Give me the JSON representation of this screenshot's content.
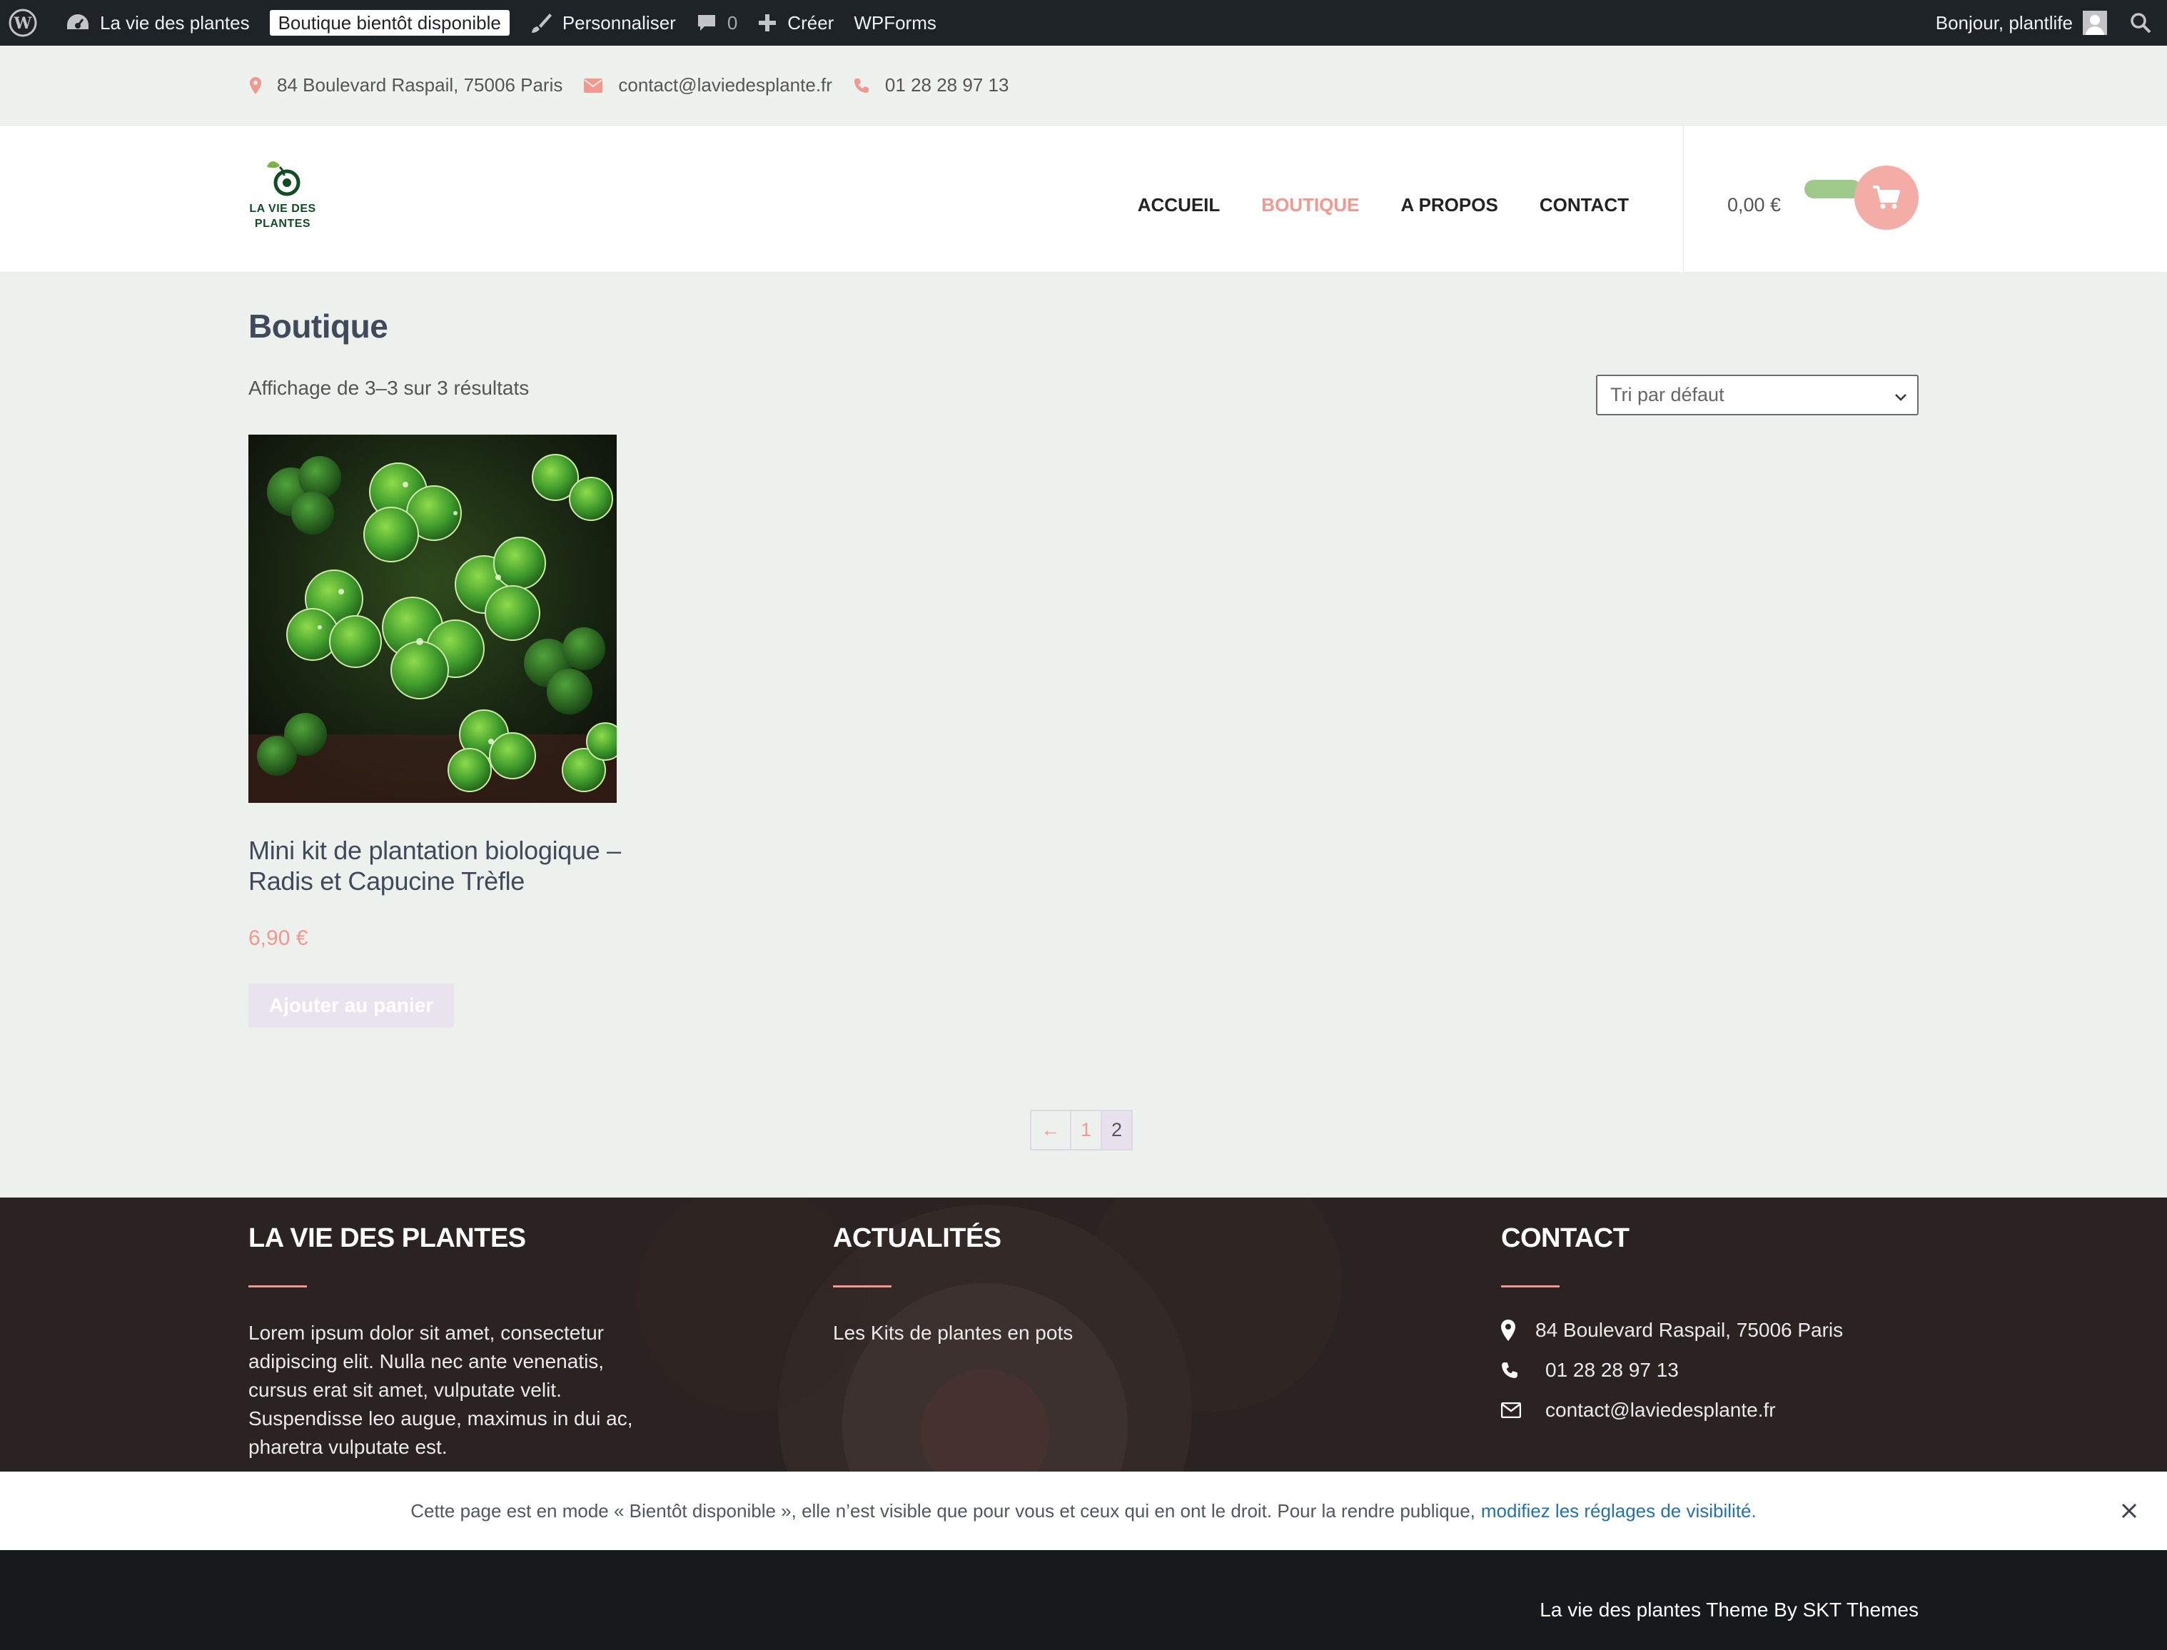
{
  "admin_bar": {
    "site_name": "La vie des plantes",
    "coming_soon_badge": "Boutique bientôt disponible",
    "customize": "Personnaliser",
    "comments_count": "0",
    "new": "Créer",
    "wpforms": "WPForms",
    "greeting": "Bonjour, plantlife"
  },
  "top_info": {
    "address": "84 Boulevard Raspail, 75006 Paris",
    "email": "contact@laviedesplante.fr",
    "phone": "01 28 28 97 13"
  },
  "header": {
    "logo_line1": "LA VIE DES",
    "logo_line2": "PLANTES",
    "nav": [
      {
        "label": "ACCUEIL",
        "active": false
      },
      {
        "label": "BOUTIQUE",
        "active": true
      },
      {
        "label": "A PROPOS",
        "active": false
      },
      {
        "label": "CONTACT",
        "active": false
      }
    ],
    "cart_total": "0,00 €"
  },
  "main": {
    "title": "Boutique",
    "result_count": "Affichage de 3–3 sur 3 résultats",
    "sort": {
      "selected": "Tri par défaut"
    },
    "product": {
      "title": "Mini kit de plantation biologique – Radis et Capucine Trèfle",
      "price": "6,90 €",
      "add_to_cart": "Ajouter au panier"
    },
    "pagination": {
      "prev": "←",
      "pages": [
        "1",
        "2"
      ],
      "current": "2"
    }
  },
  "footer": {
    "about": {
      "heading": "LA VIE DES PLANTES",
      "text": "Lorem ipsum dolor sit amet, consectetur adipiscing elit. Nulla nec ante venenatis, cursus erat sit amet, vulputate velit. Suspendisse leo augue, maximus in dui ac, pharetra vulputate est."
    },
    "news": {
      "heading": "ACTUALITÉS",
      "item": "Les Kits de plantes en pots"
    },
    "contact": {
      "heading": "CONTACT",
      "address": "84 Boulevard Raspail, 75006 Paris",
      "phone": "01 28 28 97 13",
      "email": "contact@laviedesplante.fr"
    }
  },
  "notice": {
    "text": "Cette page est en mode « Bientôt disponible », elle n’est visible que pour vous et ceux qui en ont le droit. Pour la rendre publique,",
    "link": "modifiez les réglages de visibilité."
  },
  "credit": "La vie des plantes Theme By SKT Themes",
  "colors": {
    "accent": "#f4978e",
    "admin_bar": "#1d2327",
    "page_bg": "#edf1ed",
    "footer_bg": "#2a2321",
    "bottom_bar": "#171a1c",
    "cart_toggle": "#9fc98a"
  }
}
